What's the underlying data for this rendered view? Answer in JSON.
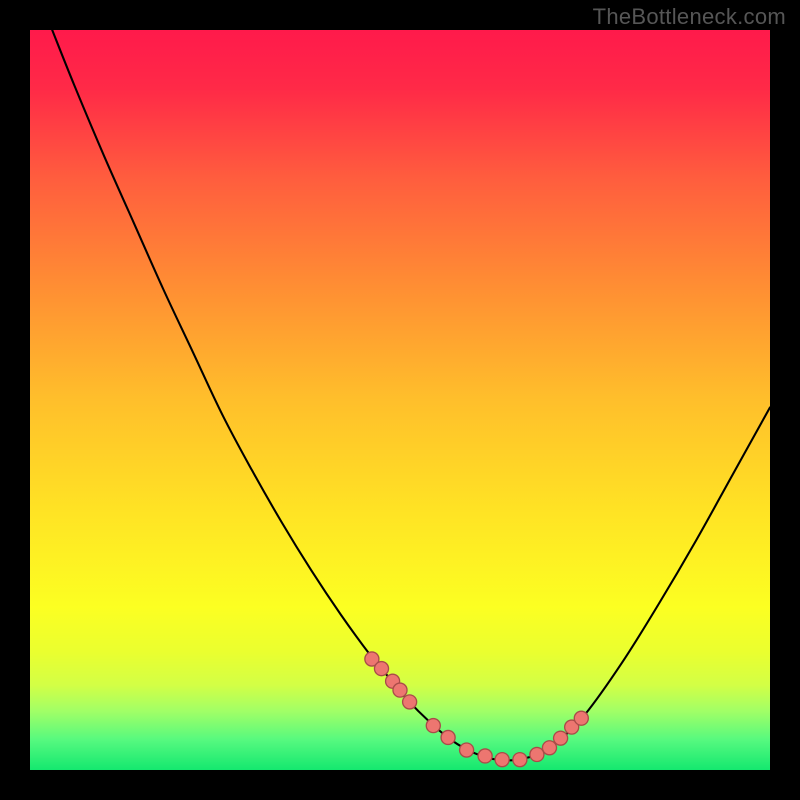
{
  "watermark": "TheBottleneck.com",
  "panel": {
    "page_size": 800,
    "margin": 30,
    "plot_size": 740
  },
  "colors": {
    "background": "#000000",
    "watermark": "#565656",
    "curve": "#000000",
    "points_fill": "#ed7670",
    "points_stroke": "#a94c49",
    "gradient_stops": [
      {
        "pos": 0.0,
        "color": "#ff1a4b"
      },
      {
        "pos": 0.08,
        "color": "#ff2a47"
      },
      {
        "pos": 0.2,
        "color": "#ff5d3e"
      },
      {
        "pos": 0.35,
        "color": "#ff8f33"
      },
      {
        "pos": 0.5,
        "color": "#ffbf2b"
      },
      {
        "pos": 0.65,
        "color": "#ffe324"
      },
      {
        "pos": 0.78,
        "color": "#fcff22"
      },
      {
        "pos": 0.84,
        "color": "#eaff2f"
      },
      {
        "pos": 0.885,
        "color": "#d3ff45"
      },
      {
        "pos": 0.92,
        "color": "#a2ff66"
      },
      {
        "pos": 0.96,
        "color": "#55f97f"
      },
      {
        "pos": 1.0,
        "color": "#14e86f"
      }
    ]
  },
  "chart_data": {
    "type": "line",
    "title": "",
    "xlabel": "",
    "ylabel": "",
    "xlim": [
      0,
      100
    ],
    "ylim": [
      0,
      100
    ],
    "note": "x is horizontal percent, y is vertical percent (0 at top, 100 at bottom) of the inner plot area",
    "series": [
      {
        "name": "bottleneck-curve",
        "x": [
          3,
          6,
          10,
          14,
          18,
          22,
          26,
          30,
          34,
          38,
          42,
          46,
          48.5,
          51,
          54,
          57,
          60,
          63,
          66,
          69,
          71.5,
          75,
          80,
          85,
          90,
          95,
          100
        ],
        "y": [
          0,
          7.5,
          17,
          26,
          35,
          43.5,
          52,
          59.5,
          66.5,
          73,
          79,
          84.5,
          87.5,
          90.5,
          93.5,
          96,
          97.7,
          98.6,
          98.6,
          97.7,
          96,
          92.5,
          85.5,
          77.5,
          69,
          60,
          51
        ]
      }
    ],
    "points": {
      "name": "highlighted-range",
      "x": [
        46.2,
        47.5,
        49,
        50,
        51.3,
        54.5,
        56.5,
        59,
        61.5,
        63.8,
        66.2,
        68.5,
        70.2,
        71.7,
        73.2,
        74.5
      ],
      "y": [
        85,
        86.3,
        88,
        89.2,
        90.8,
        94,
        95.6,
        97.3,
        98.1,
        98.6,
        98.6,
        97.9,
        97,
        95.7,
        94.2,
        93
      ]
    }
  }
}
